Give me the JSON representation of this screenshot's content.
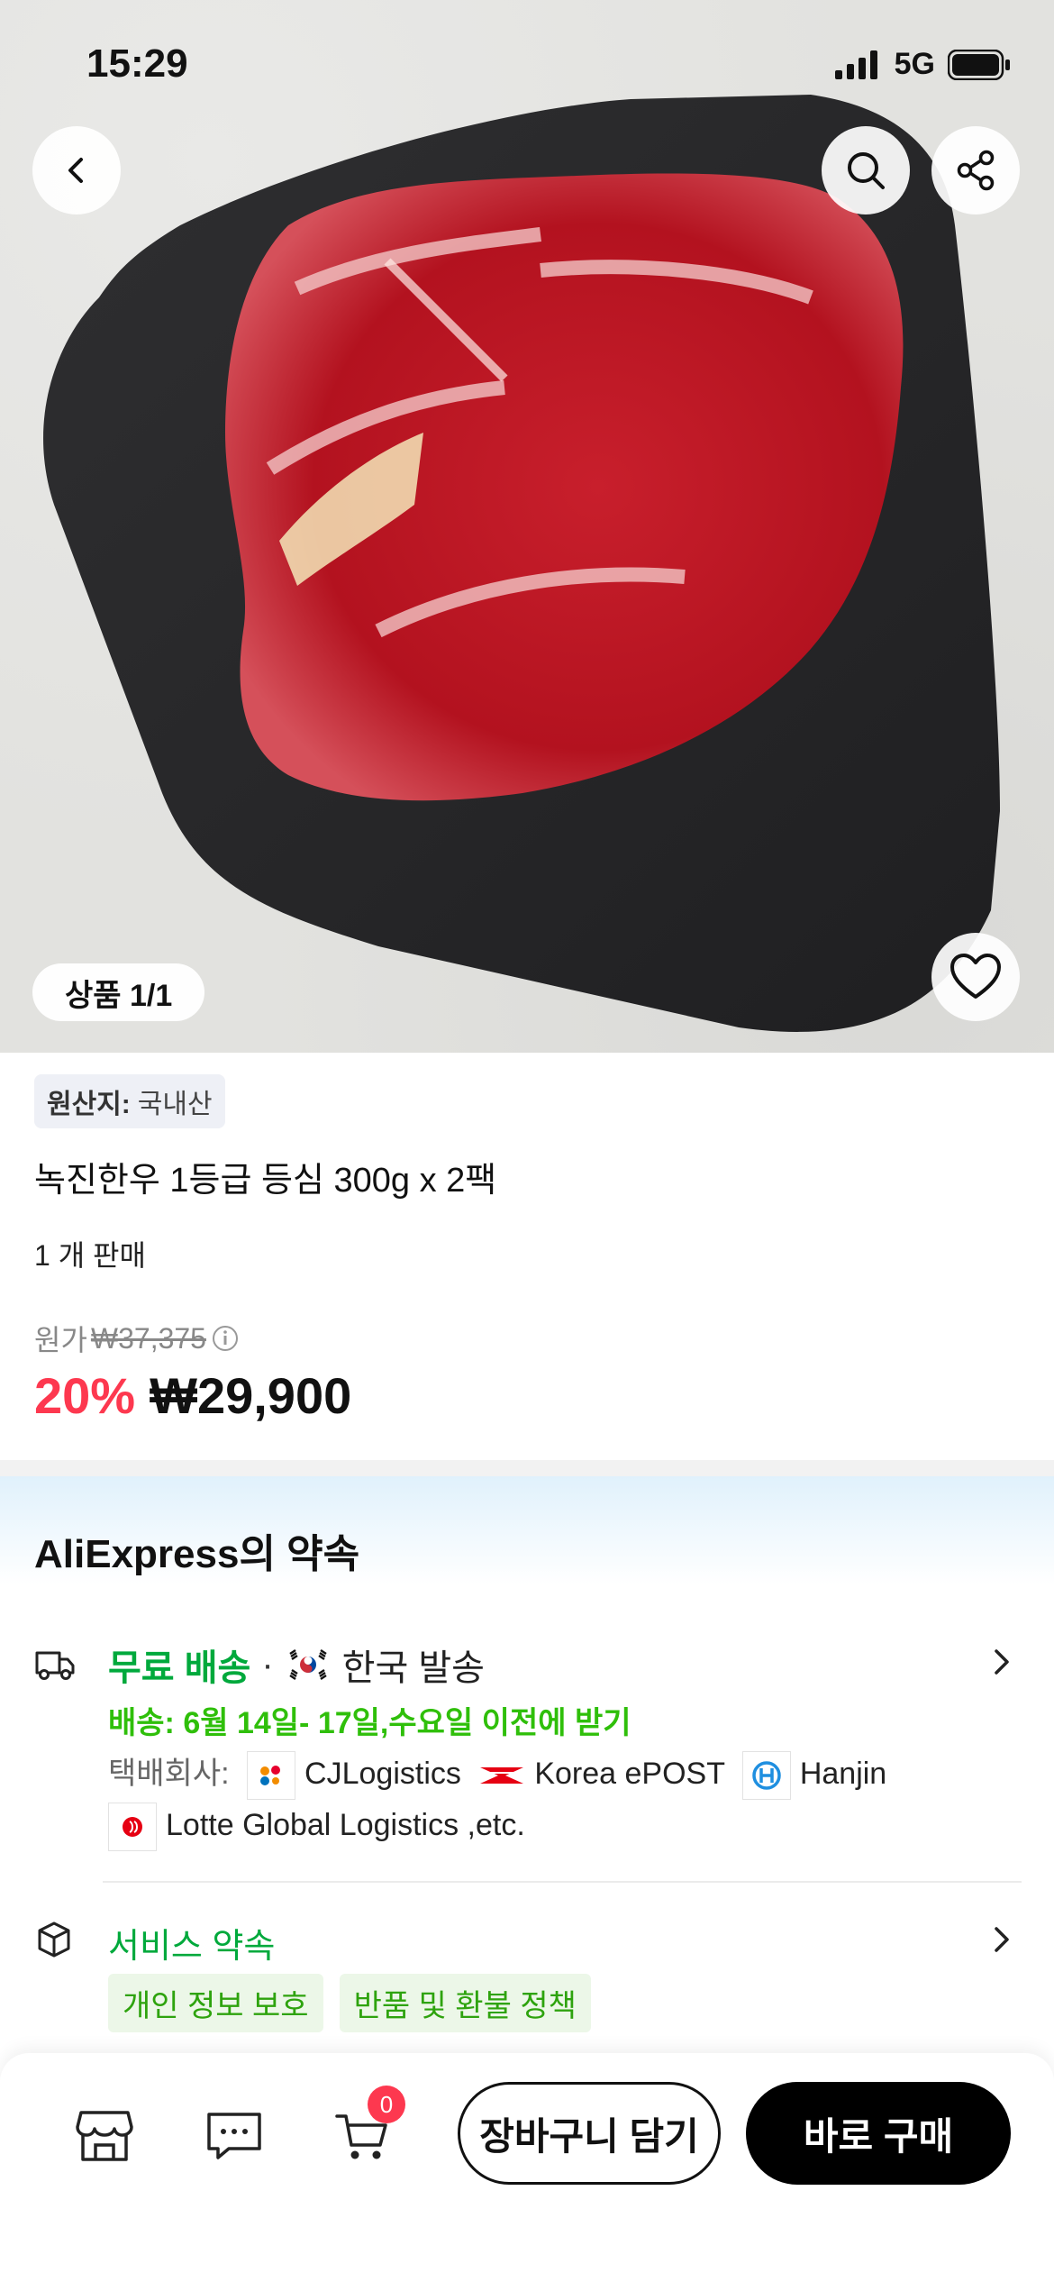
{
  "status_bar": {
    "time": "15:29",
    "network": "5G"
  },
  "gallery": {
    "counter": "상품 1/1"
  },
  "product": {
    "origin_label": "원산지:",
    "origin_value": "국내산",
    "title": "녹진한우 1등급 등심 300g x 2팩",
    "sold": "1 개 판매",
    "original_price_label": "원가",
    "original_price": "₩37,375",
    "discount": "20%",
    "price": "₩29,900"
  },
  "promise": {
    "title": "AliExpress의 약속",
    "shipping": {
      "free_label": "무료 배송",
      "separator": "·",
      "origin": "한국 발송",
      "date": "배송: 6월 14일- 17일,수요일 이전에 받기",
      "carriers_label": "택배회사:",
      "carriers": [
        "CJLogistics",
        "Korea ePOST",
        "Hanjin",
        "Lotte Global Logistics ,etc."
      ]
    },
    "service": {
      "label": "서비스 약속",
      "tags": [
        "개인 정보 보호",
        "반품 및 환불 정책"
      ]
    }
  },
  "bottom_bar": {
    "cart_count": "0",
    "add_to_cart": "장바구니 담기",
    "buy_now": "바로 구매"
  },
  "icons": [
    "back-icon",
    "search-icon",
    "share-icon",
    "heart-icon",
    "truck-icon",
    "shield-box-icon",
    "store-icon",
    "chat-icon",
    "cart-icon",
    "chevron-right-icon"
  ],
  "colors": {
    "accent_red": "#fd384f",
    "green": "#00a93c",
    "buy_button": "#000000"
  }
}
